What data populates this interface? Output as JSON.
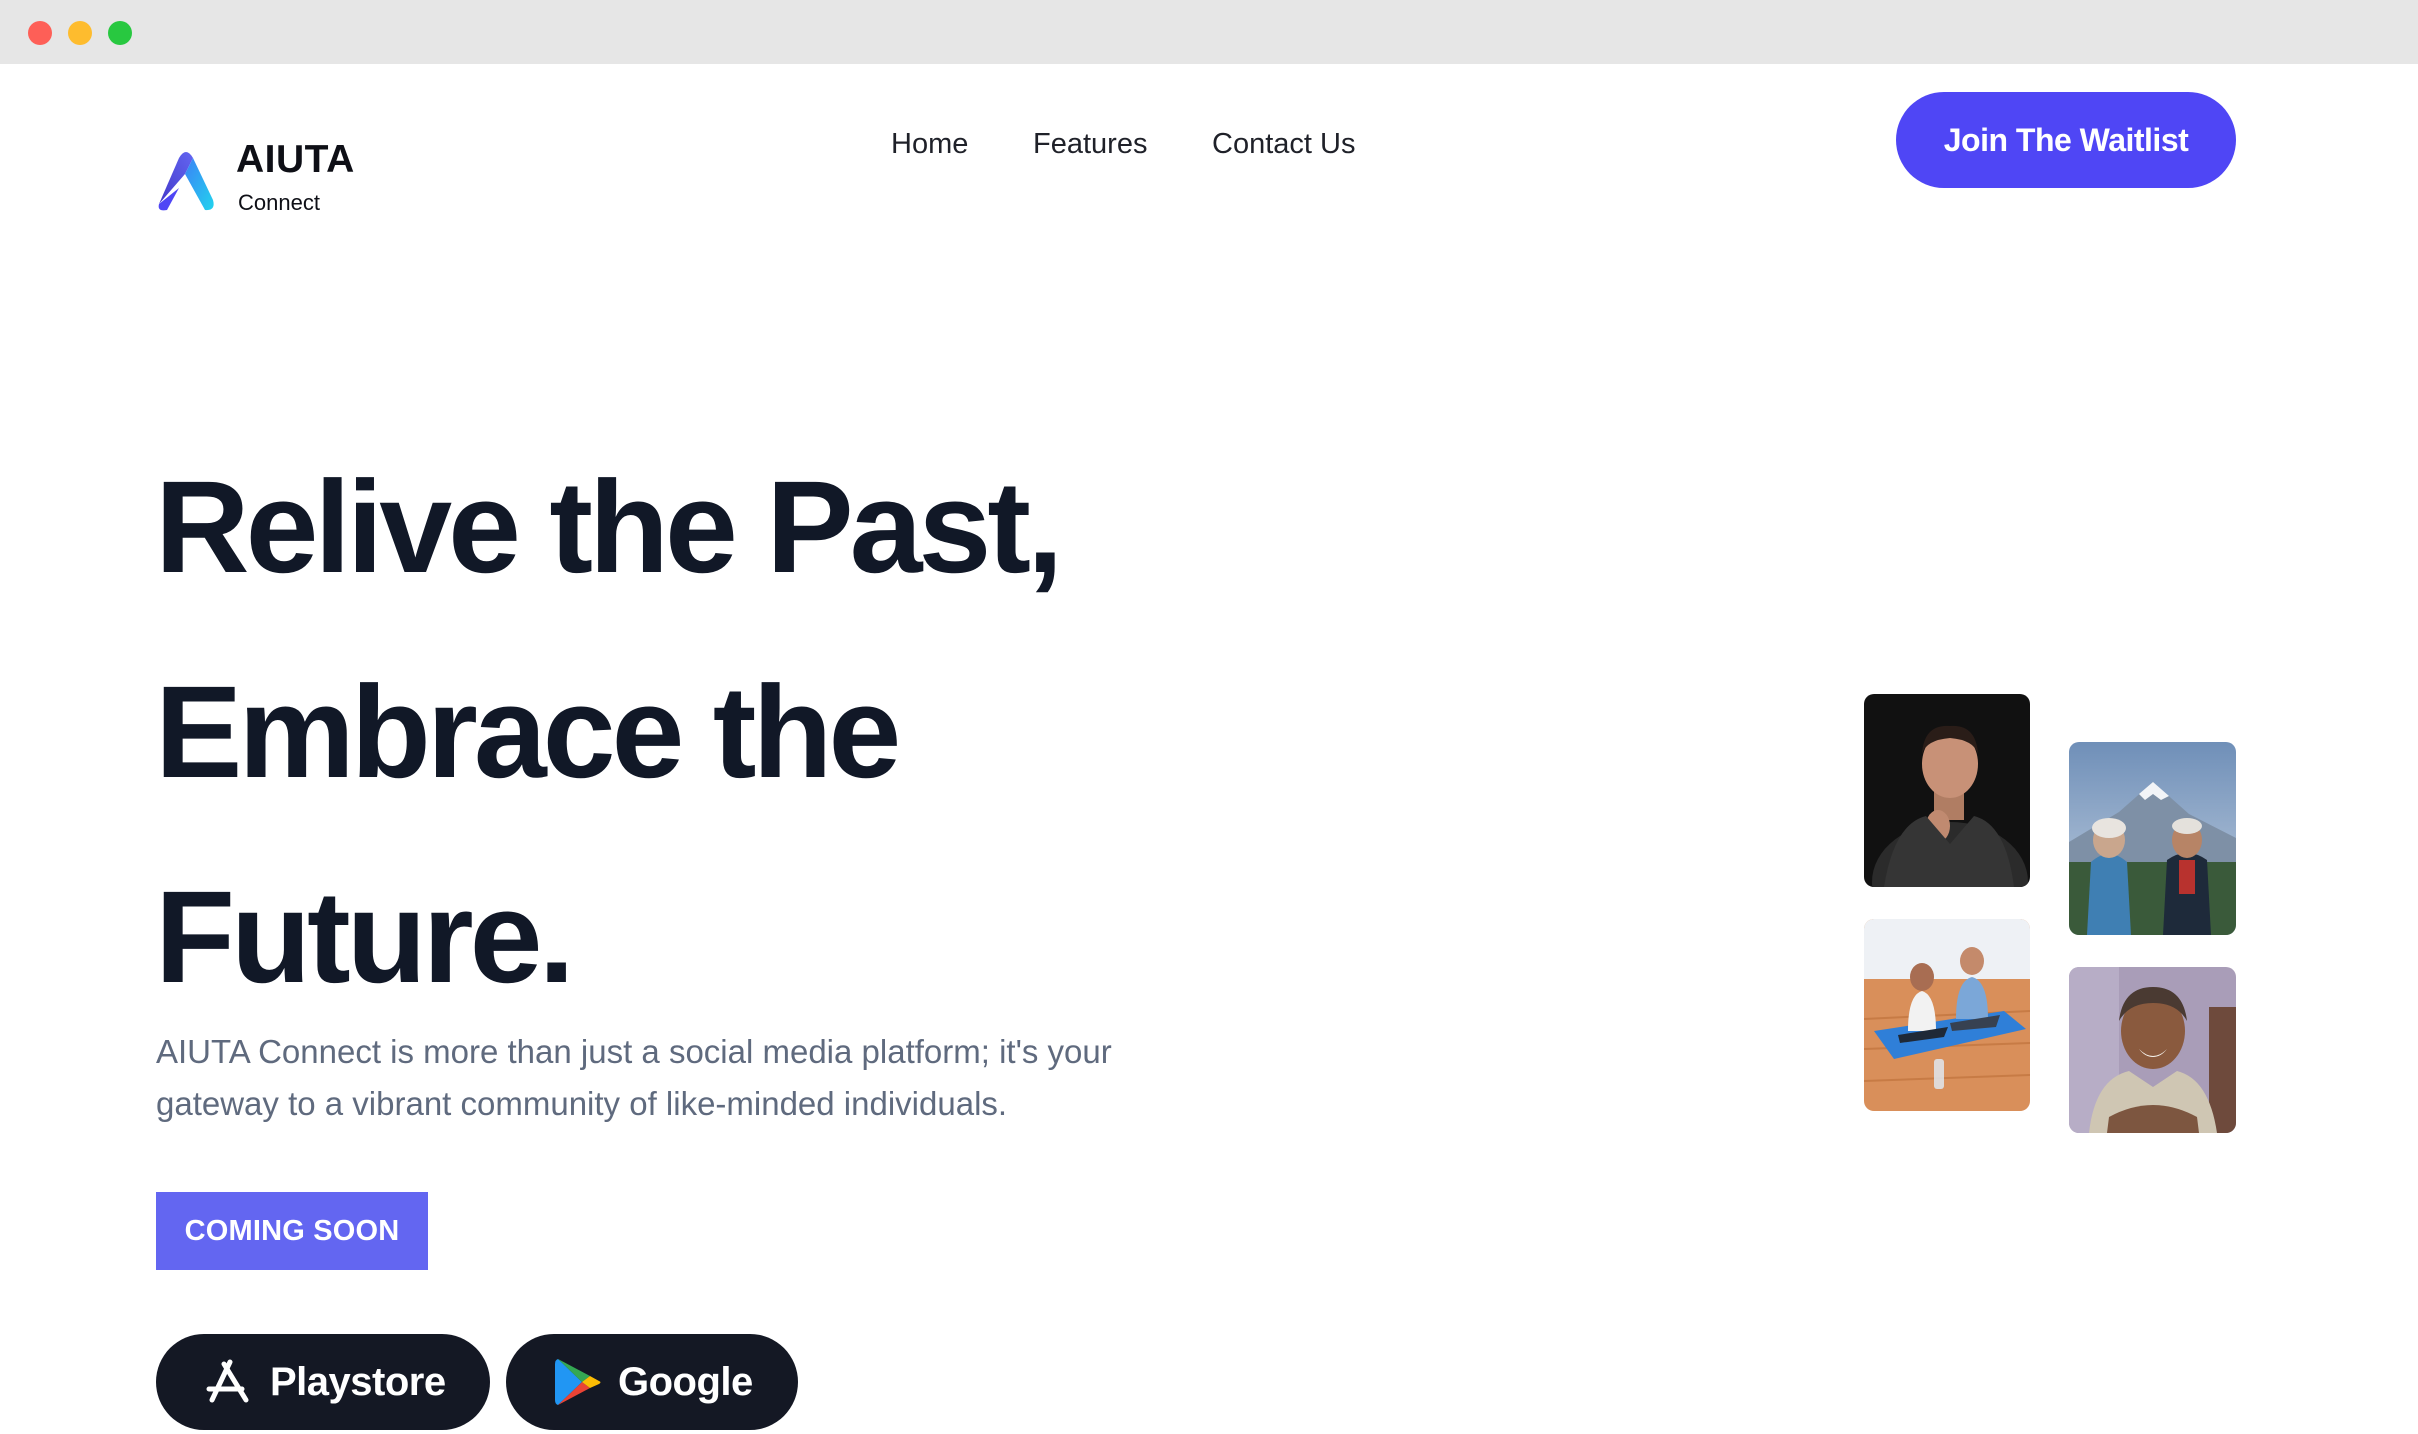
{
  "window": {
    "controls": [
      "close",
      "minimize",
      "maximize"
    ]
  },
  "header": {
    "logo": {
      "title": "AIUTA",
      "subtitle": "Connect",
      "icon": "aiuta-logo-icon",
      "colors": [
        "#4f46f5",
        "#22d3ee"
      ]
    },
    "nav": [
      {
        "label": "Home"
      },
      {
        "label": "Features"
      },
      {
        "label": "Contact Us"
      }
    ],
    "cta": {
      "label": "Join The Waitlist",
      "color": "#4f46f5"
    }
  },
  "hero": {
    "title_lines": [
      "Relive the Past,",
      "Embrace the",
      "Future."
    ],
    "description_lines": [
      "AIUTA Connect is more than just a social media platform; it's your",
      "gateway to a vibrant community of like-minded individuals."
    ],
    "badge": {
      "label": "COMING SOON",
      "color": "#6366f1"
    },
    "stores": [
      {
        "label": "Playstore",
        "icon": "app-store-icon"
      },
      {
        "label": "Google",
        "icon": "google-play-icon"
      }
    ]
  },
  "gallery": {
    "photos": [
      {
        "name": "portrait-man-dark-background"
      },
      {
        "name": "two-seniors-mountain"
      },
      {
        "name": "couple-yoga-mat"
      },
      {
        "name": "smiling-senior-woman"
      }
    ]
  }
}
